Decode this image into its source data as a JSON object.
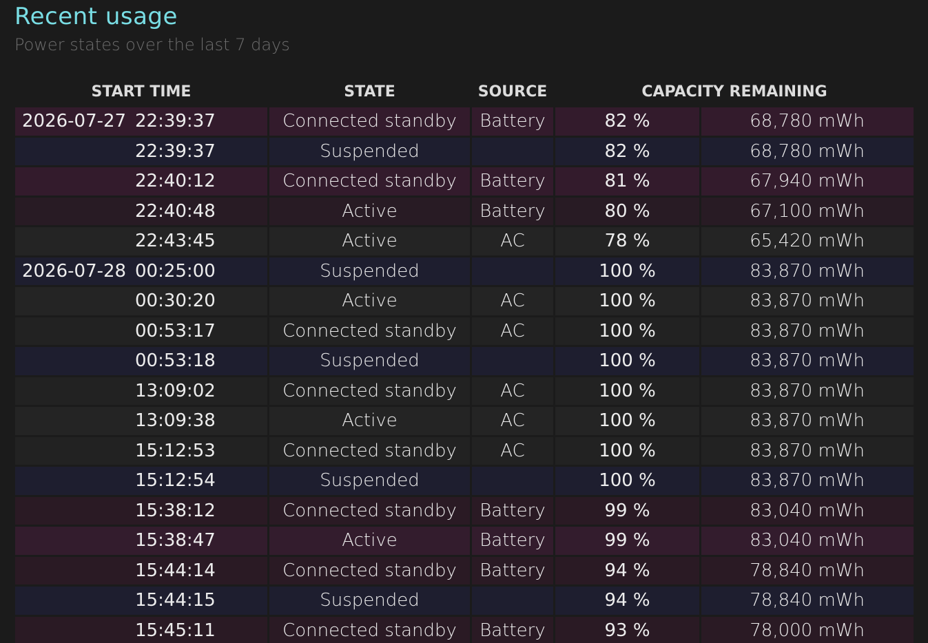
{
  "header": {
    "title": "Recent usage",
    "subtitle": "Power states over the last 7 days"
  },
  "table": {
    "columns": [
      "START TIME",
      "STATE",
      "SOURCE",
      "CAPACITY REMAINING"
    ],
    "rows": [
      {
        "date": "2026-07-27",
        "time": "22:39:37",
        "state": "Connected standby",
        "source": "Battery",
        "percent": "82 %",
        "mwh": "68,780 mWh"
      },
      {
        "date": "",
        "time": "22:39:37",
        "state": "Suspended",
        "source": "",
        "percent": "82 %",
        "mwh": "68,780 mWh"
      },
      {
        "date": "",
        "time": "22:40:12",
        "state": "Connected standby",
        "source": "Battery",
        "percent": "81 %",
        "mwh": "67,940 mWh"
      },
      {
        "date": "",
        "time": "22:40:48",
        "state": "Active",
        "source": "Battery",
        "percent": "80 %",
        "mwh": "67,100 mWh"
      },
      {
        "date": "",
        "time": "22:43:45",
        "state": "Active",
        "source": "AC",
        "percent": "78 %",
        "mwh": "65,420 mWh"
      },
      {
        "date": "2026-07-28",
        "time": "00:25:00",
        "state": "Suspended",
        "source": "",
        "percent": "100 %",
        "mwh": "83,870 mWh"
      },
      {
        "date": "",
        "time": "00:30:20",
        "state": "Active",
        "source": "AC",
        "percent": "100 %",
        "mwh": "83,870 mWh"
      },
      {
        "date": "",
        "time": "00:53:17",
        "state": "Connected standby",
        "source": "AC",
        "percent": "100 %",
        "mwh": "83,870 mWh"
      },
      {
        "date": "",
        "time": "00:53:18",
        "state": "Suspended",
        "source": "",
        "percent": "100 %",
        "mwh": "83,870 mWh"
      },
      {
        "date": "",
        "time": "13:09:02",
        "state": "Connected standby",
        "source": "AC",
        "percent": "100 %",
        "mwh": "83,870 mWh"
      },
      {
        "date": "",
        "time": "13:09:38",
        "state": "Active",
        "source": "AC",
        "percent": "100 %",
        "mwh": "83,870 mWh"
      },
      {
        "date": "",
        "time": "15:12:53",
        "state": "Connected standby",
        "source": "AC",
        "percent": "100 %",
        "mwh": "83,870 mWh"
      },
      {
        "date": "",
        "time": "15:12:54",
        "state": "Suspended",
        "source": "",
        "percent": "100 %",
        "mwh": "83,870 mWh"
      },
      {
        "date": "",
        "time": "15:38:12",
        "state": "Connected standby",
        "source": "Battery",
        "percent": "99 %",
        "mwh": "83,040 mWh"
      },
      {
        "date": "",
        "time": "15:38:47",
        "state": "Active",
        "source": "Battery",
        "percent": "99 %",
        "mwh": "83,040 mWh"
      },
      {
        "date": "",
        "time": "15:44:14",
        "state": "Connected standby",
        "source": "Battery",
        "percent": "94 %",
        "mwh": "78,840 mWh"
      },
      {
        "date": "",
        "time": "15:44:15",
        "state": "Suspended",
        "source": "",
        "percent": "94 %",
        "mwh": "78,840 mWh"
      },
      {
        "date": "",
        "time": "15:45:11",
        "state": "Connected standby",
        "source": "Battery",
        "percent": "93 %",
        "mwh": "78,000 mWh"
      }
    ]
  },
  "colors": {
    "title": "#79dde4",
    "background": "#1b1b1b",
    "battery_standby_row": "#331b2c",
    "suspended_row": "#1e1e2f",
    "ac_row": "#222222"
  }
}
